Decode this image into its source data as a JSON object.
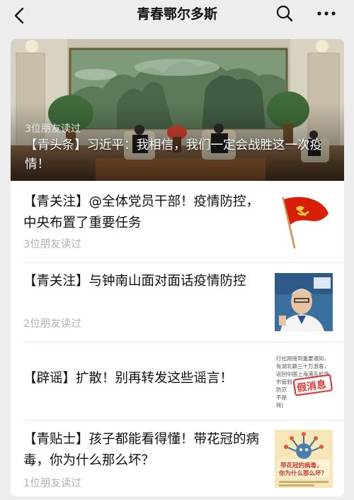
{
  "header": {
    "title": "青春鄂尔多斯",
    "back_icon": "chevron-left-icon",
    "search_icon": "search-icon",
    "more_icon": "more-horizontal-icon"
  },
  "hero": {
    "meta": "3位朋友读过",
    "title": "【青头条】习近平：我相信，我们一定会战胜这一次疫情！"
  },
  "articles": [
    {
      "title": "【青关注】@全体党员干部！疫情防控，中央布置了重要任务",
      "meta": "3位朋友读过",
      "thumb_icon": "party-flag-icon"
    },
    {
      "title": "【青关注】与钟南山面对面话疫情防控",
      "meta": "2位朋友读过",
      "thumb_icon": "portrait-photo"
    },
    {
      "title": "【辟谣】扩散！别再转发这些谣言！",
      "meta": "",
      "thumb_icon": "rumor-notice-image",
      "thumb_lines": [
        "行社刚接到重要通知，",
        "有湖北籍三十万游客，",
        "返回中国上海浦东机场，",
        "市管制，",
        "防范",
        "不是",
        "转)"
      ],
      "thumb_stamp": "假消息"
    },
    {
      "title": "【青贴士】孩子都能看得懂！带花冠的病毒，你为什么那么坏？",
      "meta": "1位朋友读过",
      "thumb_icon": "virus-cartoon-image",
      "thumb_caption": [
        "带花冠的病毒，",
        "你为什么那么坏？"
      ]
    }
  ],
  "colors": {
    "background": "#ededed",
    "card": "#ffffff",
    "meta_text": "#b2b2b2",
    "party_red": "#d81e06",
    "stamp_red": "#e23b3b"
  }
}
